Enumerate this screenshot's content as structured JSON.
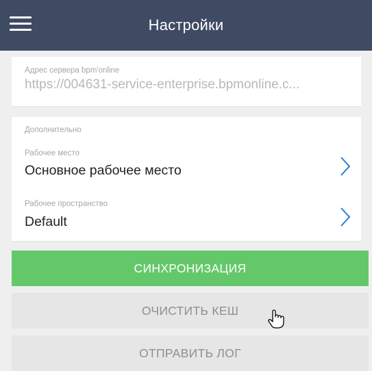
{
  "header": {
    "title": "Настройки",
    "menu_icon": "hamburger-menu-icon"
  },
  "server": {
    "label": "Адрес сервера bpm'online",
    "value": "https://004631-service-enterprise.bpmonline.c..."
  },
  "additional": {
    "section_label": "Дополнительно",
    "workplace": {
      "label": "Рабочее место",
      "value": "Основное рабочее место",
      "icon": "chevron-right-icon"
    },
    "workspace": {
      "label": "Рабочее пространство",
      "value": "Default",
      "icon": "chevron-right-icon"
    }
  },
  "buttons": {
    "sync": "СИНХРОНИЗАЦИЯ",
    "clear_cache": "ОЧИСТИТЬ КЕШ",
    "send_log": "ОТПРАВИТЬ ЛОГ"
  },
  "colors": {
    "header_bg": "#3f4b63",
    "sync_bg": "#64c86b",
    "secondary_bg": "#e6e6e6",
    "chevron": "#2a7bd5"
  },
  "pointer_icon": "hand-pointer-cursor-icon"
}
